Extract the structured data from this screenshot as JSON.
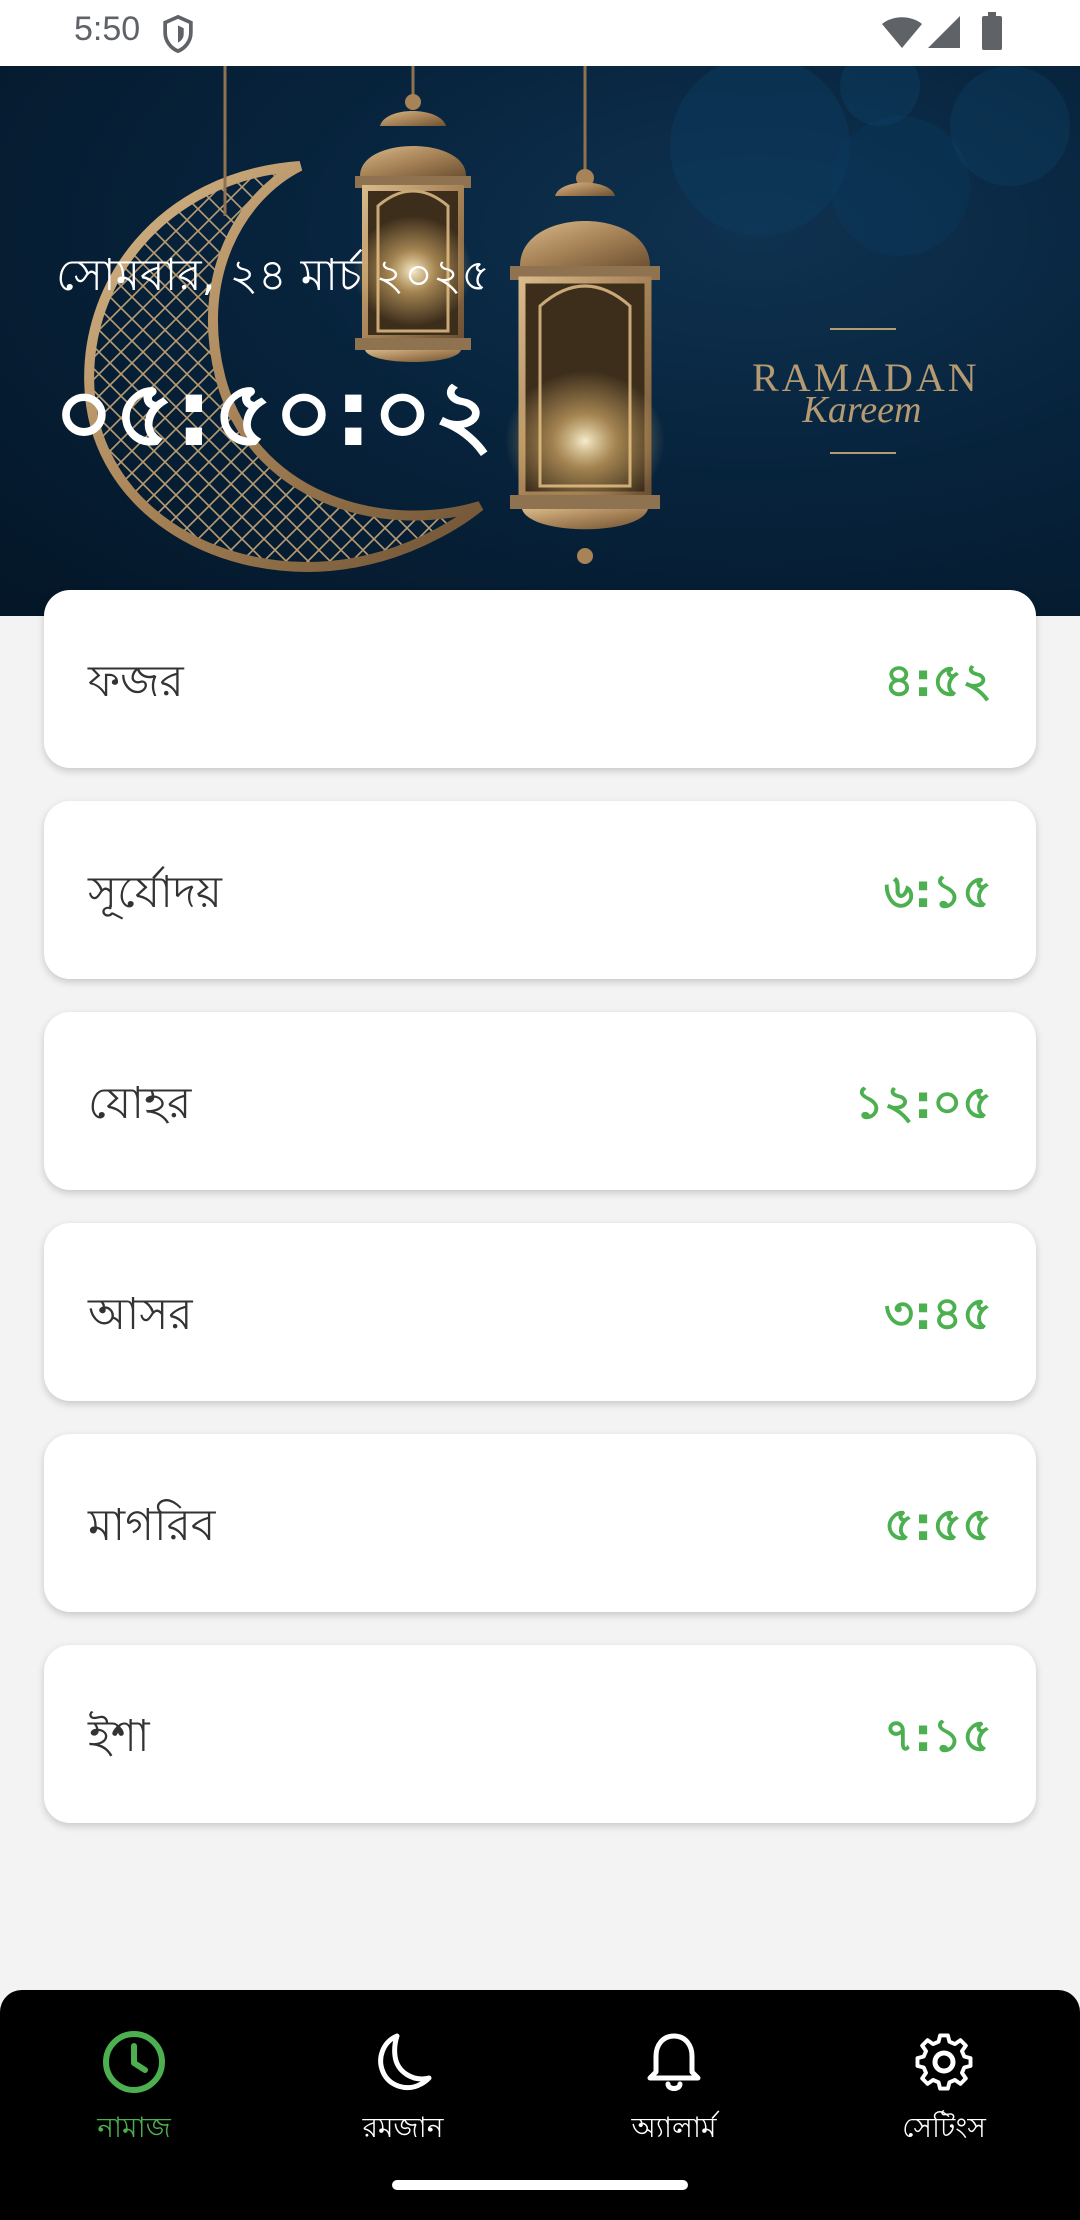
{
  "status_bar": {
    "time": "5:50",
    "icons": [
      "shield-icon",
      "wifi-icon",
      "signal-icon",
      "battery-icon"
    ]
  },
  "header": {
    "date": "সোমবার, ২৪ মার্চ ২০২৫",
    "clock": "০৫:৫০:০২",
    "banner_title": "RAMADAN",
    "banner_subtitle": "Kareem"
  },
  "prayers": [
    {
      "name": "ফজর",
      "time": "৪:৫২"
    },
    {
      "name": "সূর্যোদয়",
      "time": "৬:১৫"
    },
    {
      "name": "যোহর",
      "time": "১২:০৫"
    },
    {
      "name": "আসর",
      "time": "৩:৪৫"
    },
    {
      "name": "মাগরিব",
      "time": "৫:৫৫"
    },
    {
      "name": "ইশা",
      "time": "৭:১৫"
    }
  ],
  "nav": {
    "items": [
      {
        "label": "নামাজ",
        "icon": "clock-icon",
        "active": true
      },
      {
        "label": "রমজান",
        "icon": "moon-icon",
        "active": false
      },
      {
        "label": "অ্যালার্ম",
        "icon": "bell-icon",
        "active": false
      },
      {
        "label": "সেটিংস",
        "icon": "gear-icon",
        "active": false
      }
    ]
  },
  "colors": {
    "accent": "#4caf50",
    "header_bg": "#07233c",
    "gold": "#b69a72",
    "nav_bg": "#000000"
  }
}
